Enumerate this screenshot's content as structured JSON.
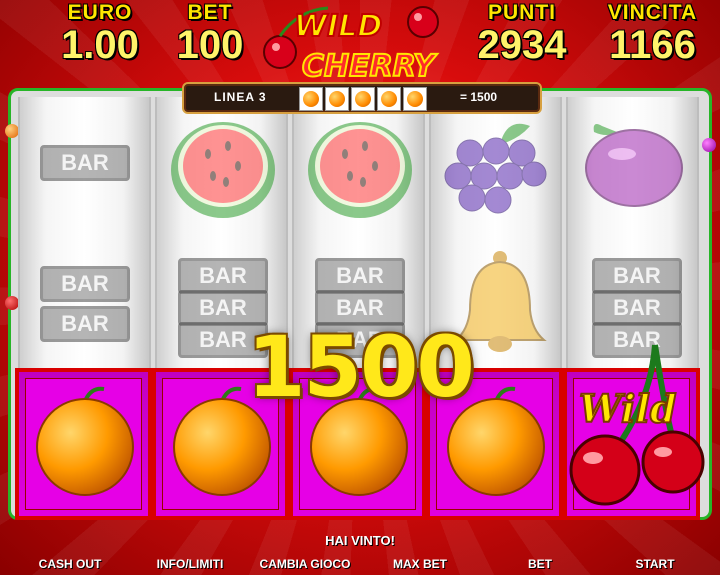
{
  "header": {
    "euro_label": "EURO",
    "euro_value": "1.00",
    "bet_label": "BET",
    "bet_value": "100",
    "punti_label": "PUNTI",
    "punti_value": "2934",
    "vincita_label": "VINCITA",
    "vincita_value": "1166"
  },
  "logo": {
    "line1": "WILD",
    "line2": "CHERRY"
  },
  "win_line": {
    "label": "LINEA 3",
    "symbols": [
      "orange",
      "orange",
      "orange",
      "orange",
      "orange"
    ],
    "win": "= 1500"
  },
  "bar_text": "BAR",
  "wild_text": "Wild",
  "big_win": "1500",
  "message": "HAI VINTO!",
  "buttons": {
    "cash_out": "CASH OUT",
    "info": "INFO/LIMITI",
    "cambia": "CAMBIA GIOCO",
    "max_bet": "MAX BET",
    "bet": "BET",
    "start": "START"
  },
  "colors": {
    "yellow": "#ffe600",
    "red_bg": "#d80c0c",
    "frame_green": "#27b527",
    "win_magenta": "#e600e6"
  }
}
